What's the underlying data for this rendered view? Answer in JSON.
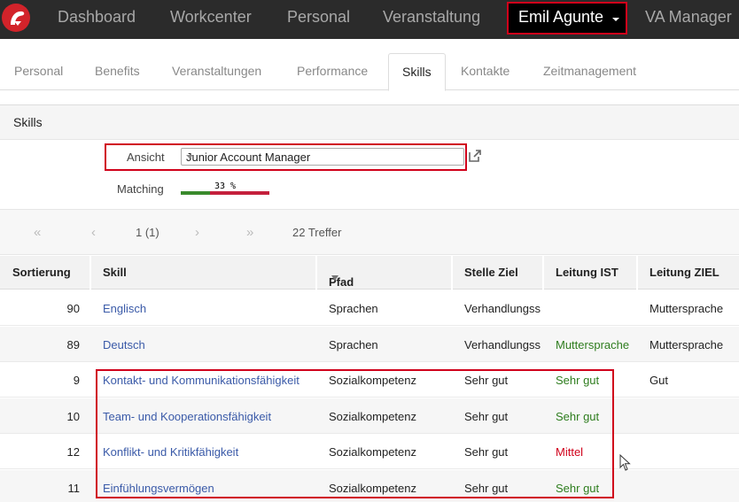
{
  "nav": {
    "items": [
      "Dashboard",
      "Workcenter",
      "Personal",
      "Veranstaltung"
    ],
    "user_name": "Emil Agunte",
    "right_item": "VA Manager"
  },
  "tabs": {
    "items": [
      "Personal",
      "Benefits",
      "Veranstaltungen",
      "Performance",
      "Skills",
      "Kontakte",
      "Zeitmanagement"
    ],
    "active": "Skills"
  },
  "panel": {
    "title": "Skills",
    "ansicht_label": "Ansicht",
    "ansicht_value": "Junior Account Manager",
    "matching_label": "Matching",
    "matching_percent_text": "33 %",
    "matching_fraction": 0.33
  },
  "pager": {
    "first": "«",
    "prev": "‹",
    "page": "1 (1)",
    "next": "›",
    "last": "»",
    "hits": "22 Treffer"
  },
  "table": {
    "headers": [
      "Sortierung",
      "Skill",
      "Pfad",
      "Stelle Ziel",
      "Leitung IST",
      "Leitung ZIEL"
    ],
    "rows": [
      {
        "sort": "90",
        "skill": "Englisch",
        "pfad": "Sprachen",
        "stelle": "Verhandlungss",
        "ist": "",
        "ziel": "Muttersprache"
      },
      {
        "sort": "89",
        "skill": "Deutsch",
        "pfad": "Sprachen",
        "stelle": "Verhandlungss",
        "ist": "Muttersprache",
        "ziel": "Muttersprache"
      },
      {
        "sort": "9",
        "skill": "Kontakt- und Kommunikationsfähigkeit",
        "pfad": "Sozialkompetenz",
        "stelle": "Sehr gut",
        "ist": "Sehr gut",
        "ziel": "Gut"
      },
      {
        "sort": "10",
        "skill": "Team- und Kooperationsfähigkeit",
        "pfad": "Sozialkompetenz",
        "stelle": "Sehr gut",
        "ist": "Sehr gut",
        "ziel": ""
      },
      {
        "sort": "12",
        "skill": "Konflikt- und Kritikfähigkeit",
        "pfad": "Sozialkompetenz",
        "stelle": "Sehr gut",
        "ist": "Mittel",
        "ziel": ""
      },
      {
        "sort": "11",
        "skill": "Einfühlungsvermögen",
        "pfad": "Sozialkompetenz",
        "stelle": "Sehr gut",
        "ist": "Sehr gut",
        "ziel": ""
      }
    ],
    "ist_colors": [
      "",
      "green",
      "green",
      "green",
      "red",
      "green"
    ]
  },
  "colors": {
    "accent_red": "#d0021b",
    "link_blue": "#3a5aa8",
    "status_green": "#2e7d1e",
    "nav_bg": "#2b2b2b"
  }
}
